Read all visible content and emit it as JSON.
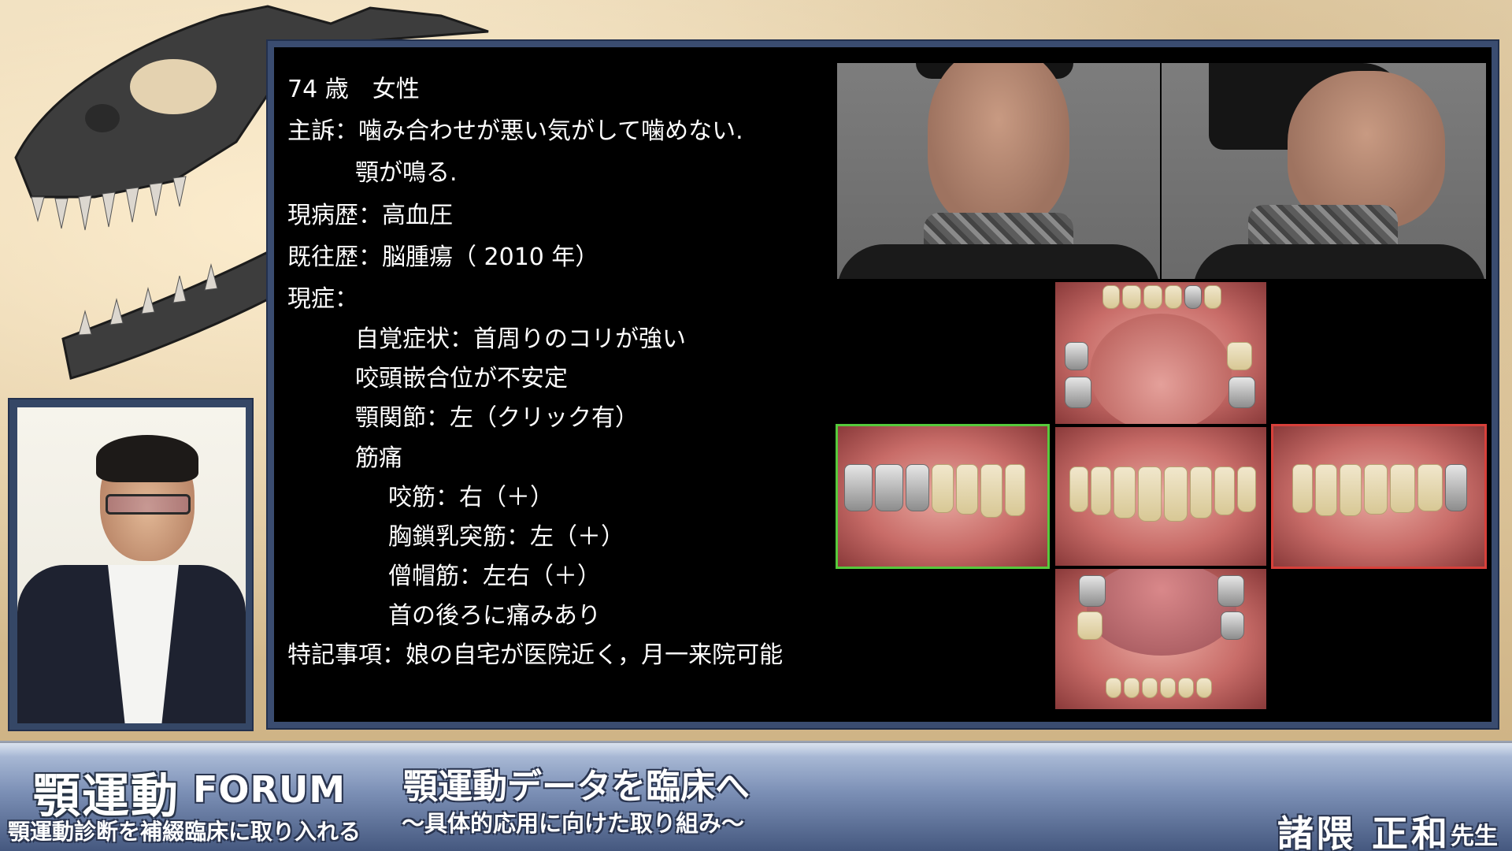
{
  "slide": {
    "lines": [
      "74 歳　女性",
      "主訴：噛み合わせが悪い気がして噛めない.",
      "顎が鳴る.",
      "現病歴：高血圧",
      "既往歴：脳腫瘍（ 2010 年）",
      "現症：",
      "自覚症状：首周りのコリが強い",
      "咬頭嵌合位が不安定",
      "顎関節：左（クリック有）",
      "筋痛",
      "咬筋：右（＋）",
      "胸鎖乳突筋：左（＋）",
      "僧帽筋：左右（＋）",
      "首の後ろに痛みあり",
      "特記事項：娘の自宅が医院近く，月一来院可能"
    ]
  },
  "banner": {
    "logo_title": "顎運動",
    "logo_forum": "FORUM",
    "logo_sub": "顎運動診断を補綴臨床に取り入れる",
    "topic_title": "顎運動データを臨床へ",
    "topic_sub": "〜具体的応用に向けた取り組み〜",
    "speaker_name": "諸隈 正和",
    "speaker_honorific": "先生"
  },
  "colors": {
    "frame_blue": "#3a4c70",
    "green_frame": "#56c93c",
    "red_frame": "#d8403a"
  }
}
